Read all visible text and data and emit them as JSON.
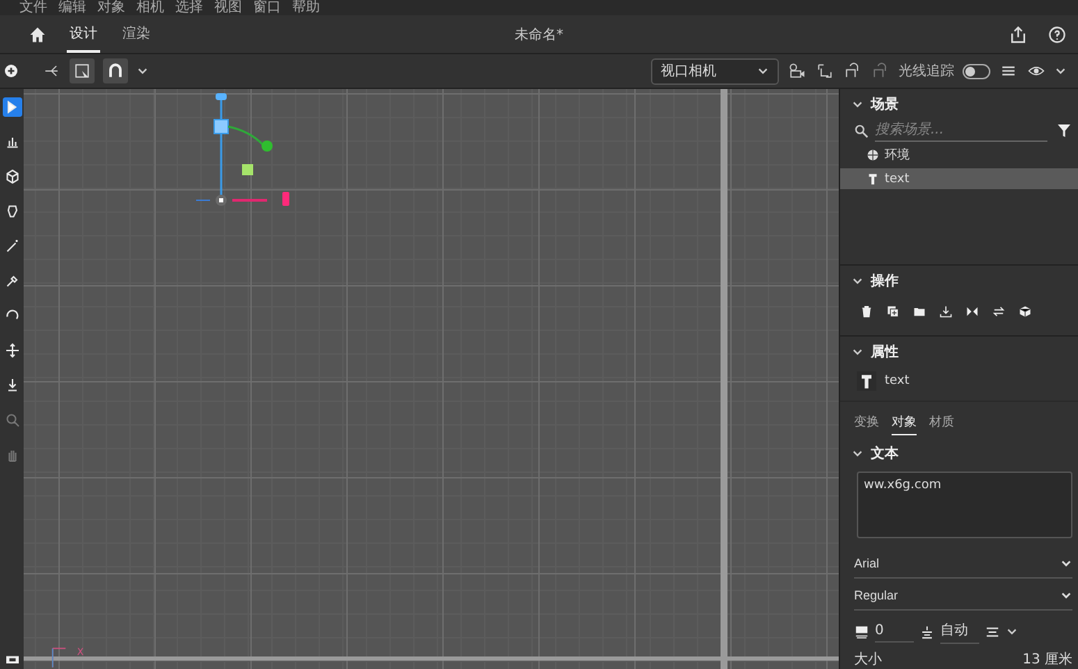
{
  "menu": [
    "文件",
    "编辑",
    "对象",
    "相机",
    "选择",
    "视图",
    "窗口",
    "帮助"
  ],
  "tabs": [
    {
      "label": "设计",
      "selected": true
    },
    {
      "label": "渲染",
      "selected": false
    }
  ],
  "document_title": "未命名*",
  "toolbar": {
    "camera": "视口相机",
    "ray_tracing": {
      "label": "光线追踪",
      "on": false
    }
  },
  "left_tools": [
    {
      "kind": "select",
      "selected": true,
      "disabled": false
    },
    {
      "kind": "chart",
      "selected": false,
      "disabled": false
    },
    {
      "kind": "cube",
      "selected": false,
      "disabled": false
    },
    {
      "kind": "model",
      "selected": false,
      "disabled": false
    },
    {
      "kind": "wand",
      "selected": false,
      "disabled": false
    },
    {
      "kind": "dropper",
      "selected": false,
      "disabled": false
    },
    {
      "kind": "orbit",
      "selected": false,
      "disabled": false
    },
    {
      "kind": "move",
      "selected": false,
      "disabled": false
    },
    {
      "kind": "dolly",
      "selected": false,
      "disabled": false
    },
    {
      "kind": "zoom",
      "selected": false,
      "disabled": true
    },
    {
      "kind": "hand",
      "selected": false,
      "disabled": true
    }
  ],
  "viewport": {
    "axis_label": "X"
  },
  "scene": {
    "title": "场景",
    "search_placeholder": "搜索场景...",
    "items": [
      {
        "label": "环境",
        "kind": "environment",
        "selected": false
      },
      {
        "label": "text",
        "kind": "text",
        "selected": true
      }
    ]
  },
  "actions": {
    "title": "操作"
  },
  "properties": {
    "title": "属性",
    "object_label": "text",
    "tabs": [
      {
        "label": "变换",
        "selected": false
      },
      {
        "label": "对象",
        "selected": true
      },
      {
        "label": "材质",
        "selected": false
      }
    ],
    "text_section": {
      "title": "文本",
      "value": "ww.x6g.com"
    },
    "font": "Arial",
    "style": "Regular",
    "tracking": "0",
    "leading": "自动",
    "size_label": "大小",
    "size_value": "13 厘米"
  }
}
